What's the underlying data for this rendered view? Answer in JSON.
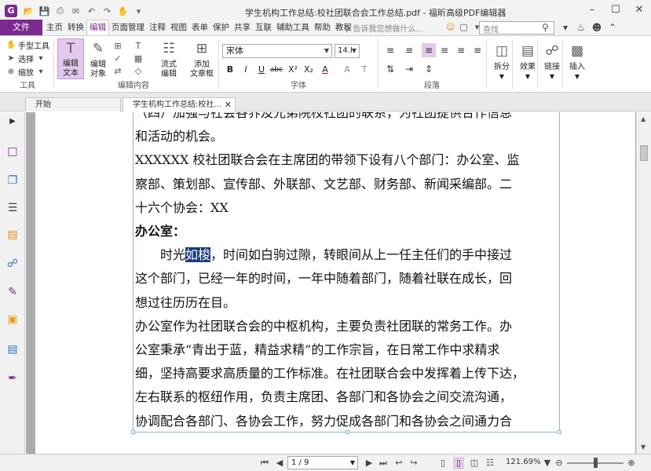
{
  "app": {
    "logo_letter": "G",
    "window_title": "学生机构工作总结:校社团联合会工作总结.pdf - 福昕高级PDF编辑器"
  },
  "menu": {
    "file_label": "文件",
    "tabs": [
      "主页",
      "转换",
      "编辑",
      "页面管理",
      "注释",
      "视图",
      "表单",
      "保护",
      "共享",
      "互联",
      "辅助工具",
      "帮助",
      "教程"
    ],
    "active_tab": "编辑",
    "tell_me_placeholder": "告诉我您想做什么...",
    "search_placeholder": "查找"
  },
  "ribbon": {
    "tools_group": {
      "label": "工具",
      "items": [
        "手型工具",
        "选择",
        "缩放"
      ]
    },
    "edit_content_group": {
      "label": "编辑内容",
      "edit_text": "编辑\n文本",
      "edit_object": "编辑\n对象",
      "flow_edit": "流式\n编辑",
      "add_textbox": "添加\n文章框"
    },
    "font_group": {
      "label": "字体",
      "font_name": "宋体",
      "font_size": "14.I",
      "buttons": [
        "B",
        "I",
        "U",
        "abc",
        "X²",
        "X₂",
        "A",
        "A",
        "T"
      ]
    },
    "paragraph_group": {
      "label": "段落"
    },
    "split_label": "拆分",
    "effects_label": "效果",
    "link_label": "链接",
    "insert_label": "插入"
  },
  "doc_tabs": [
    {
      "label": "开始",
      "active": false
    },
    {
      "label": "学生机构工作总结:校社...",
      "active": true
    }
  ],
  "document": {
    "lines": [
      "（四）加强与社会各界及兄弟院校社团的联系，为社团提供合作信息",
      "和活动的机会。",
      "XXXXXX 校社团联合会在主席团的带领下设有八个部门：办公室、监",
      "察部、策划部、宣传部、外联部、文艺部、财务部、新闻采编部。二",
      "十六个协会：XX",
      "办公室：",
      "　　时光",
      "如梭",
      "，时间如白驹过隙，转眼间从上一任主任们的手中接过",
      "这个部门，已经一年的时间，一年中随着部门，随着社联在成长，回",
      "想过往历历在目。",
      "办公室作为社团联合会的中枢机构，主要负责社团联的常务工作。办",
      "公室秉承“青出于蓝，精益求精”的工作宗旨，在日常工作中求精求",
      "细，坚持高要求高质量的工作标准。在社团联合会中发挥着上传下达，",
      "左右联系的枢纽作用，负责主席团、各部门和各协会之间交流沟通，",
      "协调配合各部门、各协会工作，努力促成各部门和各协会之间通力合"
    ]
  },
  "status": {
    "page_indicator": "1 / 9",
    "zoom": "121.69%"
  },
  "colors": {
    "brand": "#7b2a8e",
    "selection": "#1a3b7a"
  }
}
